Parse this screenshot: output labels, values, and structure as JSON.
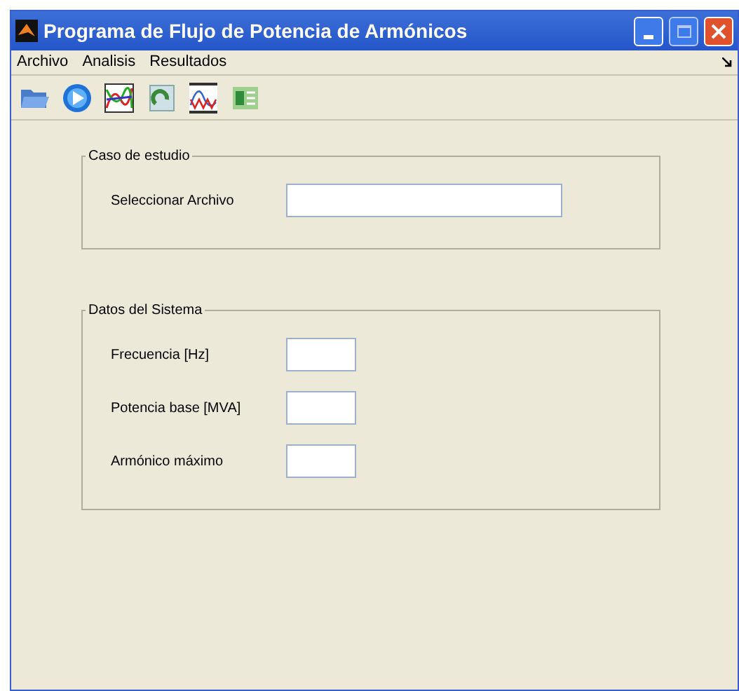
{
  "window": {
    "title": "Programa de Flujo de Potencia de Armónicos"
  },
  "menu": [
    "Archivo",
    "Analisis",
    "Resultados"
  ],
  "panels": [
    {
      "title": "Caso de estudio",
      "fields": [
        {
          "label": "Seleccionar Archivo",
          "kind": "wide"
        }
      ]
    },
    {
      "title": "Datos del Sistema",
      "fields": [
        {
          "label": "Frecuencia [Hz]",
          "kind": "short"
        },
        {
          "label": "Potencia base [MVA]",
          "kind": "short"
        },
        {
          "label": "Armónico máximo",
          "kind": "short"
        }
      ]
    }
  ]
}
